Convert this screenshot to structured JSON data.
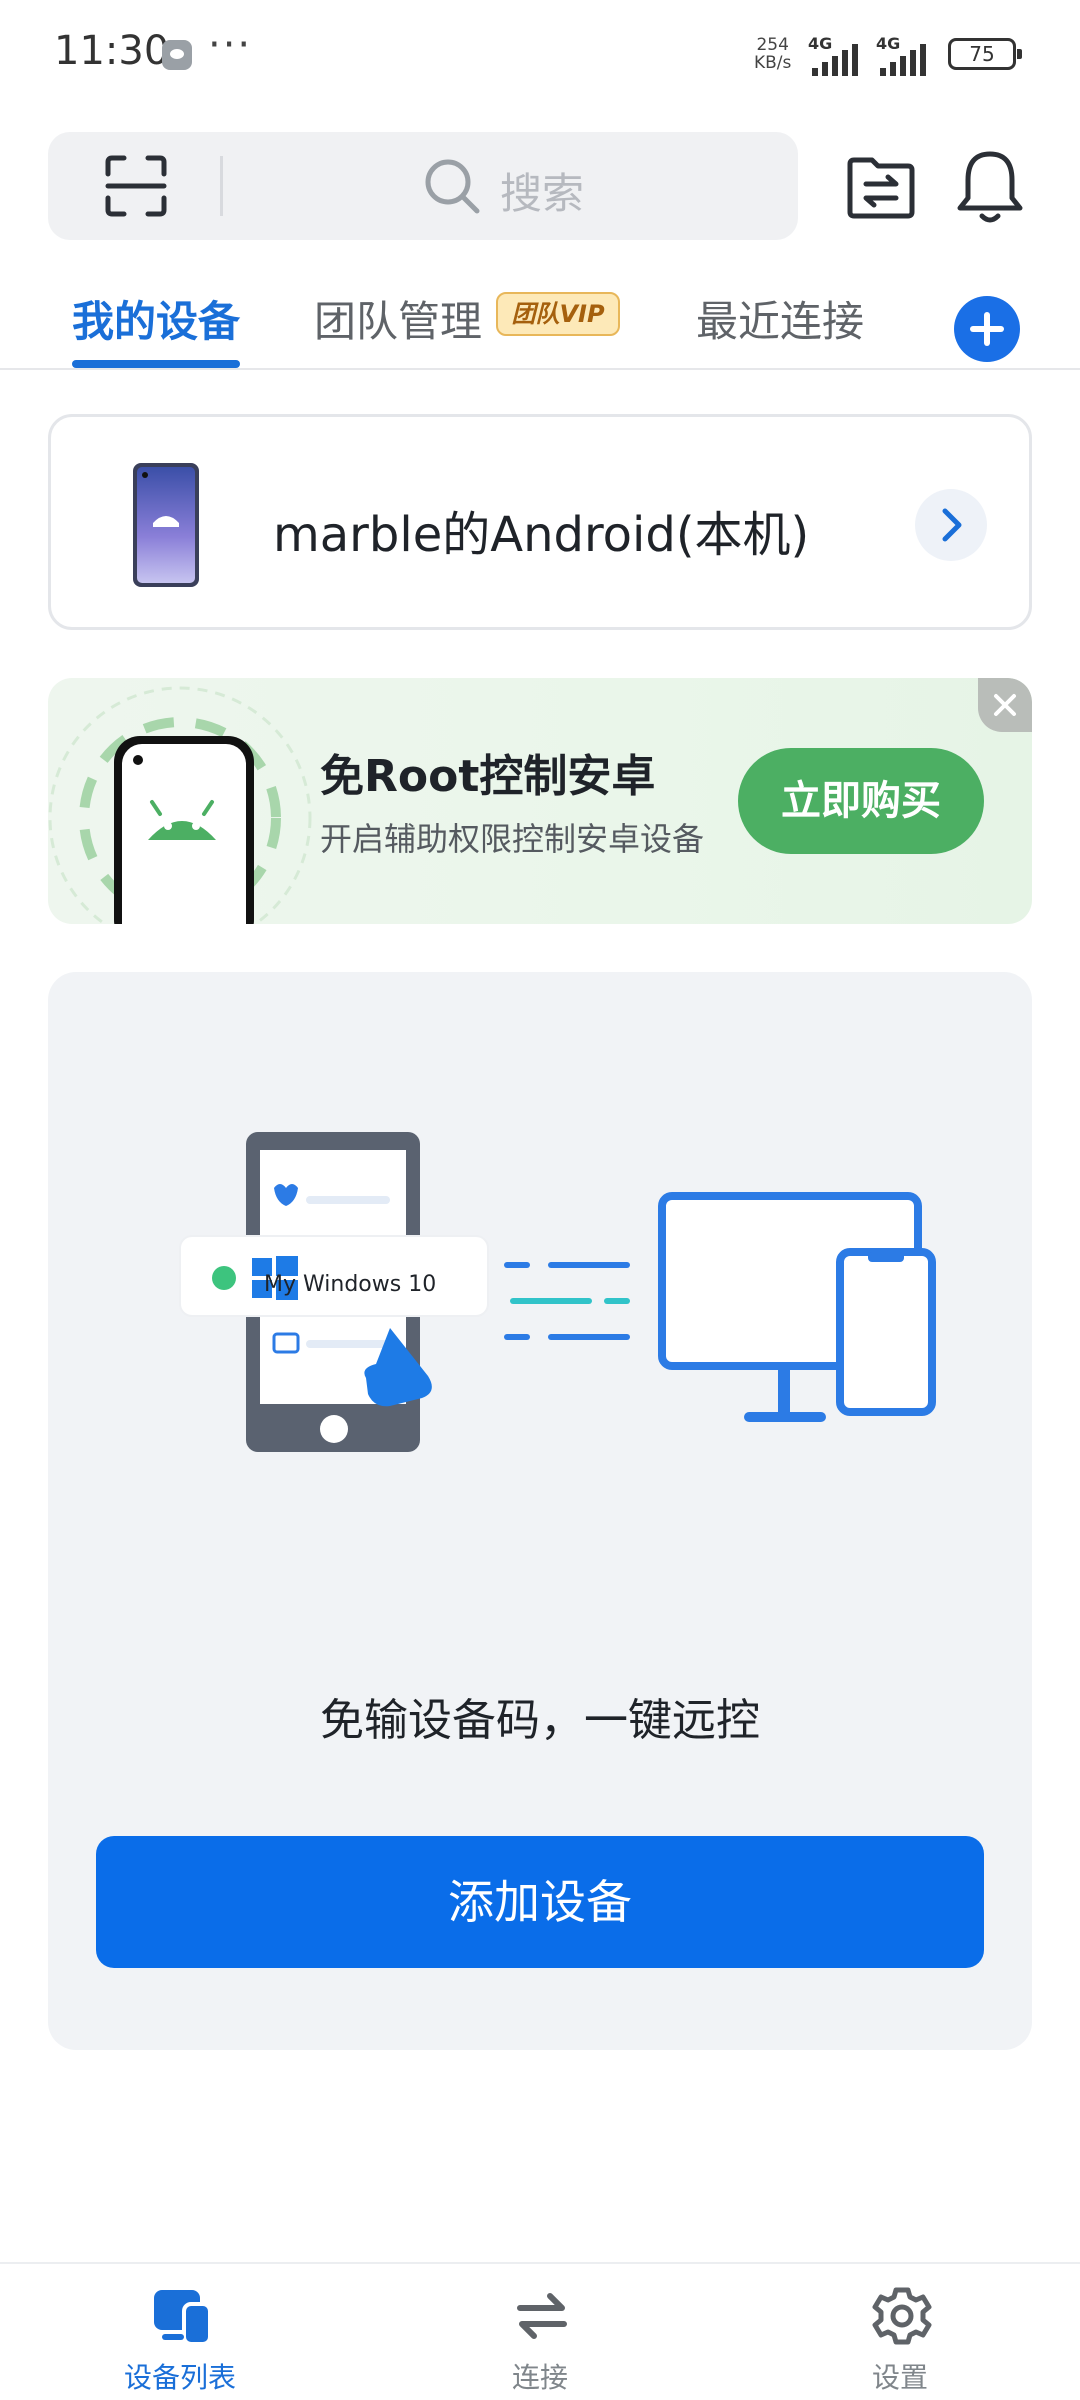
{
  "status_bar": {
    "time": "11:30",
    "more": "···",
    "speed_value": "254",
    "speed_unit": "KB/s",
    "signal1": "4G",
    "signal2": "4G",
    "battery": "75"
  },
  "header": {
    "search_placeholder": "搜索",
    "icons": [
      "scan-icon",
      "search-icon",
      "file-transfer-icon",
      "bell-icon"
    ]
  },
  "tabs": [
    {
      "label": "我的设备",
      "active": true
    },
    {
      "label": "团队管理",
      "badge": "团队VIP"
    },
    {
      "label": "最近连接"
    }
  ],
  "device": {
    "name": "marble的Android(本机)"
  },
  "promo": {
    "title": "免Root控制安卓",
    "subtitle": "开启辅助权限控制安卓设备",
    "button": "立即购买"
  },
  "empty_state": {
    "card_label": "My Windows 10",
    "tagline": "免输设备码，一键远控",
    "button": "添加设备"
  },
  "bottom_nav": [
    {
      "label": "设备列表",
      "active": true
    },
    {
      "label": "连接"
    },
    {
      "label": "设置"
    }
  ],
  "colors": {
    "accent": "#1a6fd8",
    "primary_button": "#0a6de9",
    "promo_button": "#4caf63",
    "vip_badge_bg": "#fde9b8"
  }
}
